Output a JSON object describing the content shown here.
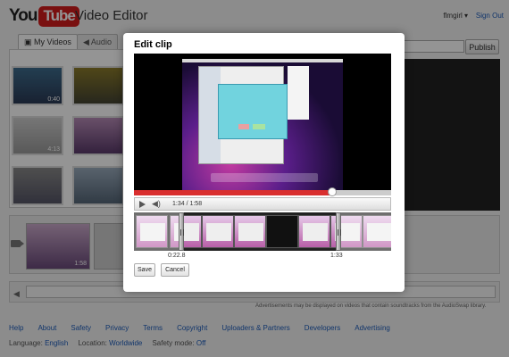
{
  "header": {
    "logo_you": "You",
    "logo_tube": "Tube",
    "app_title": "Video Editor",
    "user": "flmgirl ▾",
    "signout": "Sign Out"
  },
  "tabs": [
    {
      "label": "▣ My Videos",
      "icon": "film-icon"
    },
    {
      "label": "◀ Audio",
      "icon": "speaker-icon"
    }
  ],
  "publish_label": "Publish",
  "library": {
    "thumbs": [
      {
        "duration": "0:40"
      },
      {
        "duration": ""
      },
      {
        "duration": "4:13"
      },
      {
        "duration": ""
      },
      {
        "duration": ""
      },
      {
        "duration": ""
      }
    ]
  },
  "timeline": {
    "clip_duration": "1:58"
  },
  "disclaimer": "Advertisements may be displayed on videos that contain soundtracks from the AudioSwap library.",
  "modal": {
    "title": "Edit clip",
    "time_display": "1:34 / 1:58",
    "progress_fraction": 0.77,
    "trim_start": "0:22.8",
    "trim_end": "1:33",
    "save_label": "Save",
    "cancel_label": "Cancel"
  },
  "footer": {
    "links": [
      "Help",
      "About",
      "Safety",
      "Privacy",
      "Terms",
      "Copyright",
      "Uploaders & Partners",
      "Developers",
      "Advertising"
    ],
    "language_label": "Language:",
    "language_value": "English",
    "location_label": "Location:",
    "location_value": "Worldwide",
    "safety_label": "Safety mode:",
    "safety_value": "Off"
  },
  "colors": {
    "accent_red": "#d92f2f",
    "link_blue": "#1c5bb8"
  }
}
